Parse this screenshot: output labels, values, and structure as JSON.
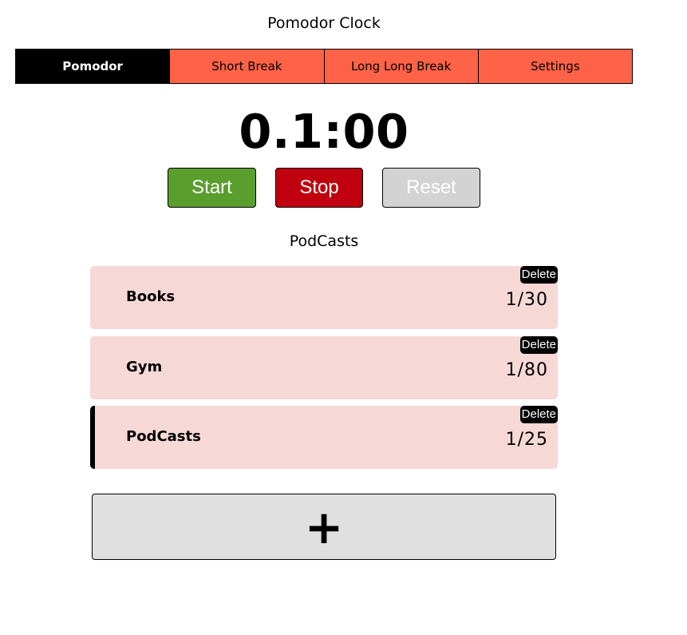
{
  "app": {
    "title": "Pomodor Clock"
  },
  "tabs": [
    {
      "label": "Pomodor",
      "active": true
    },
    {
      "label": "Short Break",
      "active": false
    },
    {
      "label": "Long Long Break",
      "active": false
    },
    {
      "label": "Settings",
      "active": false
    }
  ],
  "timer": {
    "display": "0.1:00"
  },
  "controls": {
    "start_label": "Start",
    "stop_label": "Stop",
    "reset_label": "Reset"
  },
  "current_task": {
    "name": "PodCasts"
  },
  "tasks": [
    {
      "name": "Books",
      "count": "1/30",
      "delete_label": "Delete",
      "active": false
    },
    {
      "name": "Gym",
      "count": "1/80",
      "delete_label": "Delete",
      "active": false
    },
    {
      "name": "PodCasts",
      "count": "1/25",
      "delete_label": "Delete",
      "active": true
    }
  ],
  "add_task": {
    "label": "+"
  },
  "colors": {
    "tab_bg": "#ff6347",
    "tab_active_bg": "#000000",
    "start": "#5a9e2d",
    "stop": "#c0000e",
    "reset": "#d3d3d3",
    "task_bg": "#f6d8d7",
    "add_bg": "#e0e0e0"
  }
}
